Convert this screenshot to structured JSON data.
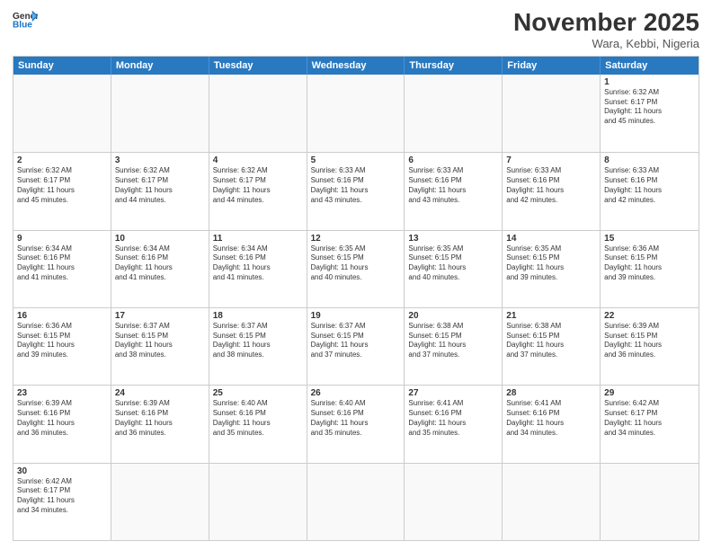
{
  "header": {
    "logo_general": "General",
    "logo_blue": "Blue",
    "month_title": "November 2025",
    "location": "Wara, Kebbi, Nigeria"
  },
  "weekdays": [
    "Sunday",
    "Monday",
    "Tuesday",
    "Wednesday",
    "Thursday",
    "Friday",
    "Saturday"
  ],
  "rows": [
    [
      {
        "day": "",
        "text": ""
      },
      {
        "day": "",
        "text": ""
      },
      {
        "day": "",
        "text": ""
      },
      {
        "day": "",
        "text": ""
      },
      {
        "day": "",
        "text": ""
      },
      {
        "day": "",
        "text": ""
      },
      {
        "day": "1",
        "text": "Sunrise: 6:32 AM\nSunset: 6:17 PM\nDaylight: 11 hours\nand 45 minutes."
      }
    ],
    [
      {
        "day": "2",
        "text": "Sunrise: 6:32 AM\nSunset: 6:17 PM\nDaylight: 11 hours\nand 45 minutes."
      },
      {
        "day": "3",
        "text": "Sunrise: 6:32 AM\nSunset: 6:17 PM\nDaylight: 11 hours\nand 44 minutes."
      },
      {
        "day": "4",
        "text": "Sunrise: 6:32 AM\nSunset: 6:17 PM\nDaylight: 11 hours\nand 44 minutes."
      },
      {
        "day": "5",
        "text": "Sunrise: 6:33 AM\nSunset: 6:16 PM\nDaylight: 11 hours\nand 43 minutes."
      },
      {
        "day": "6",
        "text": "Sunrise: 6:33 AM\nSunset: 6:16 PM\nDaylight: 11 hours\nand 43 minutes."
      },
      {
        "day": "7",
        "text": "Sunrise: 6:33 AM\nSunset: 6:16 PM\nDaylight: 11 hours\nand 42 minutes."
      },
      {
        "day": "8",
        "text": "Sunrise: 6:33 AM\nSunset: 6:16 PM\nDaylight: 11 hours\nand 42 minutes."
      }
    ],
    [
      {
        "day": "9",
        "text": "Sunrise: 6:34 AM\nSunset: 6:16 PM\nDaylight: 11 hours\nand 41 minutes."
      },
      {
        "day": "10",
        "text": "Sunrise: 6:34 AM\nSunset: 6:16 PM\nDaylight: 11 hours\nand 41 minutes."
      },
      {
        "day": "11",
        "text": "Sunrise: 6:34 AM\nSunset: 6:16 PM\nDaylight: 11 hours\nand 41 minutes."
      },
      {
        "day": "12",
        "text": "Sunrise: 6:35 AM\nSunset: 6:15 PM\nDaylight: 11 hours\nand 40 minutes."
      },
      {
        "day": "13",
        "text": "Sunrise: 6:35 AM\nSunset: 6:15 PM\nDaylight: 11 hours\nand 40 minutes."
      },
      {
        "day": "14",
        "text": "Sunrise: 6:35 AM\nSunset: 6:15 PM\nDaylight: 11 hours\nand 39 minutes."
      },
      {
        "day": "15",
        "text": "Sunrise: 6:36 AM\nSunset: 6:15 PM\nDaylight: 11 hours\nand 39 minutes."
      }
    ],
    [
      {
        "day": "16",
        "text": "Sunrise: 6:36 AM\nSunset: 6:15 PM\nDaylight: 11 hours\nand 39 minutes."
      },
      {
        "day": "17",
        "text": "Sunrise: 6:37 AM\nSunset: 6:15 PM\nDaylight: 11 hours\nand 38 minutes."
      },
      {
        "day": "18",
        "text": "Sunrise: 6:37 AM\nSunset: 6:15 PM\nDaylight: 11 hours\nand 38 minutes."
      },
      {
        "day": "19",
        "text": "Sunrise: 6:37 AM\nSunset: 6:15 PM\nDaylight: 11 hours\nand 37 minutes."
      },
      {
        "day": "20",
        "text": "Sunrise: 6:38 AM\nSunset: 6:15 PM\nDaylight: 11 hours\nand 37 minutes."
      },
      {
        "day": "21",
        "text": "Sunrise: 6:38 AM\nSunset: 6:15 PM\nDaylight: 11 hours\nand 37 minutes."
      },
      {
        "day": "22",
        "text": "Sunrise: 6:39 AM\nSunset: 6:15 PM\nDaylight: 11 hours\nand 36 minutes."
      }
    ],
    [
      {
        "day": "23",
        "text": "Sunrise: 6:39 AM\nSunset: 6:16 PM\nDaylight: 11 hours\nand 36 minutes."
      },
      {
        "day": "24",
        "text": "Sunrise: 6:39 AM\nSunset: 6:16 PM\nDaylight: 11 hours\nand 36 minutes."
      },
      {
        "day": "25",
        "text": "Sunrise: 6:40 AM\nSunset: 6:16 PM\nDaylight: 11 hours\nand 35 minutes."
      },
      {
        "day": "26",
        "text": "Sunrise: 6:40 AM\nSunset: 6:16 PM\nDaylight: 11 hours\nand 35 minutes."
      },
      {
        "day": "27",
        "text": "Sunrise: 6:41 AM\nSunset: 6:16 PM\nDaylight: 11 hours\nand 35 minutes."
      },
      {
        "day": "28",
        "text": "Sunrise: 6:41 AM\nSunset: 6:16 PM\nDaylight: 11 hours\nand 34 minutes."
      },
      {
        "day": "29",
        "text": "Sunrise: 6:42 AM\nSunset: 6:17 PM\nDaylight: 11 hours\nand 34 minutes."
      }
    ],
    [
      {
        "day": "30",
        "text": "Sunrise: 6:42 AM\nSunset: 6:17 PM\nDaylight: 11 hours\nand 34 minutes."
      },
      {
        "day": "",
        "text": ""
      },
      {
        "day": "",
        "text": ""
      },
      {
        "day": "",
        "text": ""
      },
      {
        "day": "",
        "text": ""
      },
      {
        "day": "",
        "text": ""
      },
      {
        "day": "",
        "text": ""
      }
    ]
  ]
}
